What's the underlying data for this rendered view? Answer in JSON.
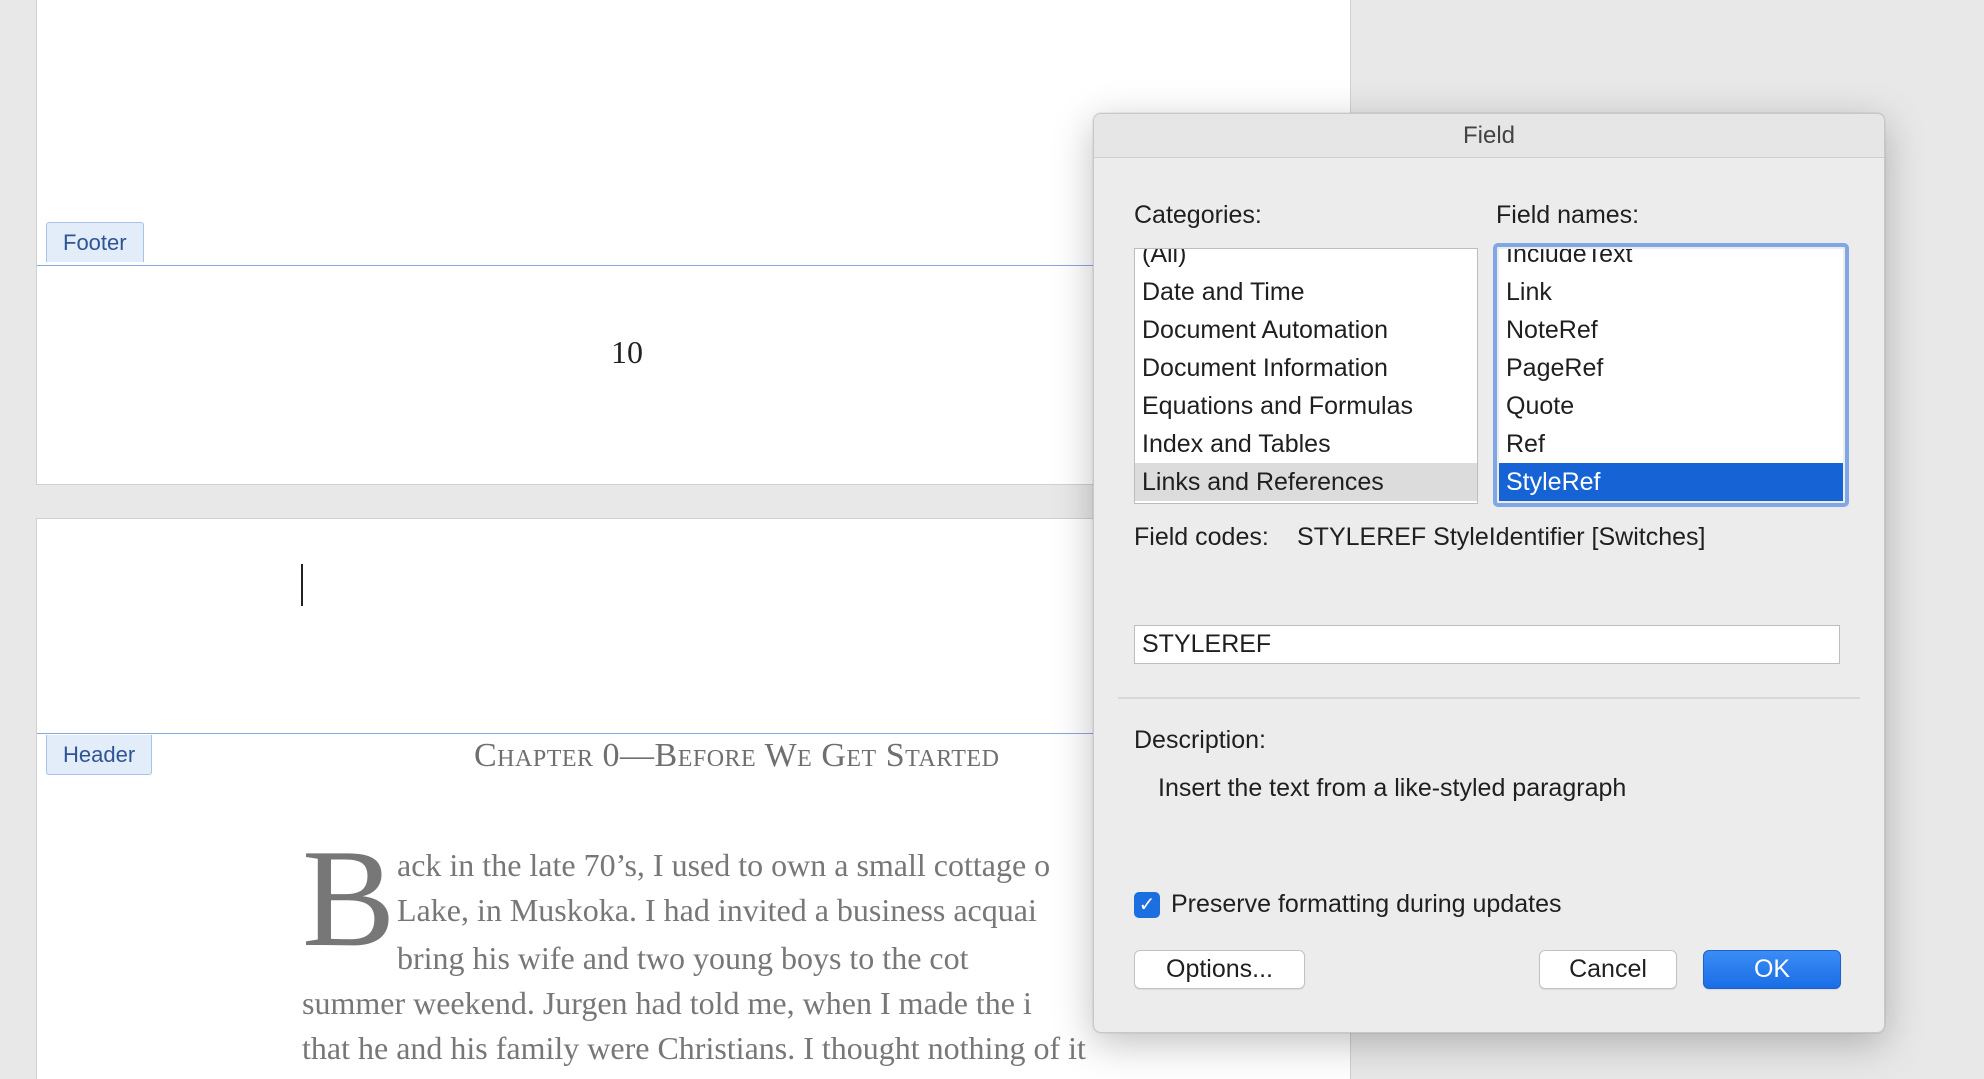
{
  "document": {
    "footer_tab": "Footer",
    "page_number": "10",
    "header_tab": "Header",
    "running_header": "Chapter 0—Before We Get Started",
    "drop_cap": "B",
    "body_lines": [
      "ack in the late 70’s, I used to own a small cottage o",
      "Lake, in Muskoka.  I had invited a business acquai",
      "bring his wife and two young boys to the cot",
      "summer weekend. Jurgen had told me, when I made the i",
      "that he and his family were Christians.  I thought nothing of it"
    ]
  },
  "dialog": {
    "title": "Field",
    "categories_label": "Categories:",
    "field_names_label": "Field names:",
    "categories": [
      "(All)",
      "Date and Time",
      "Document Automation",
      "Document Information",
      "Equations and Formulas",
      "Index and Tables",
      "Links and References"
    ],
    "selected_category": "Links and References",
    "field_names": [
      "IncludeText",
      "Link",
      "NoteRef",
      "PageRef",
      "Quote",
      "Ref",
      "StyleRef"
    ],
    "selected_field_name": "StyleRef",
    "field_codes_label": "Field codes:",
    "field_codes_value": "STYLEREF StyleIdentifier [Switches]",
    "field_code_input": "STYLEREF",
    "description_label": "Description:",
    "description_text": "Insert the text from a like-styled paragraph",
    "preserve_formatting_label": "Preserve formatting during updates",
    "preserve_formatting_checked": true,
    "options_button": "Options...",
    "cancel_button": "Cancel",
    "ok_button": "OK"
  },
  "colors": {
    "accent": "#1663d6",
    "header_footer_line": "#86a8e0",
    "tab_background": "#e3ecf9"
  }
}
